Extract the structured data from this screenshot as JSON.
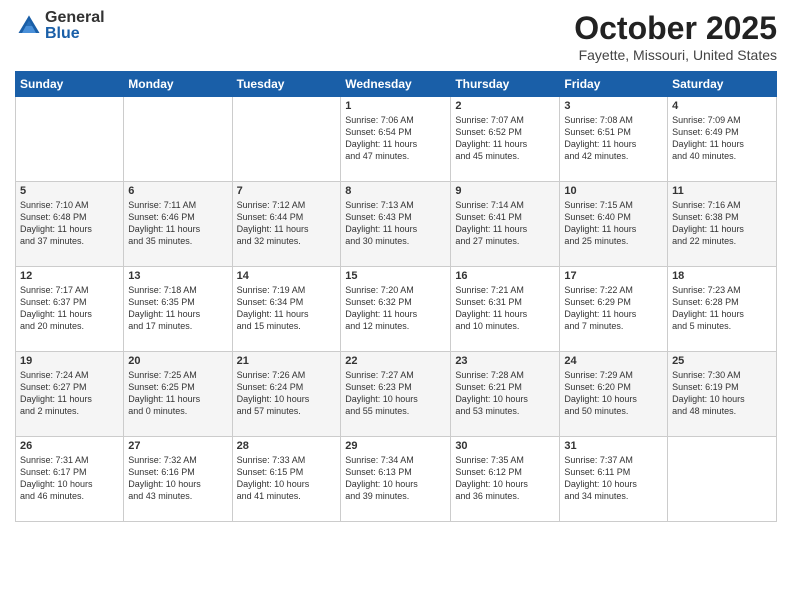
{
  "header": {
    "logo": {
      "general": "General",
      "blue": "Blue"
    },
    "title": "October 2025",
    "location": "Fayette, Missouri, United States"
  },
  "weekdays": [
    "Sunday",
    "Monday",
    "Tuesday",
    "Wednesday",
    "Thursday",
    "Friday",
    "Saturday"
  ],
  "weeks": [
    [
      {
        "day": "",
        "info": ""
      },
      {
        "day": "",
        "info": ""
      },
      {
        "day": "",
        "info": ""
      },
      {
        "day": "1",
        "info": "Sunrise: 7:06 AM\nSunset: 6:54 PM\nDaylight: 11 hours\nand 47 minutes."
      },
      {
        "day": "2",
        "info": "Sunrise: 7:07 AM\nSunset: 6:52 PM\nDaylight: 11 hours\nand 45 minutes."
      },
      {
        "day": "3",
        "info": "Sunrise: 7:08 AM\nSunset: 6:51 PM\nDaylight: 11 hours\nand 42 minutes."
      },
      {
        "day": "4",
        "info": "Sunrise: 7:09 AM\nSunset: 6:49 PM\nDaylight: 11 hours\nand 40 minutes."
      }
    ],
    [
      {
        "day": "5",
        "info": "Sunrise: 7:10 AM\nSunset: 6:48 PM\nDaylight: 11 hours\nand 37 minutes."
      },
      {
        "day": "6",
        "info": "Sunrise: 7:11 AM\nSunset: 6:46 PM\nDaylight: 11 hours\nand 35 minutes."
      },
      {
        "day": "7",
        "info": "Sunrise: 7:12 AM\nSunset: 6:44 PM\nDaylight: 11 hours\nand 32 minutes."
      },
      {
        "day": "8",
        "info": "Sunrise: 7:13 AM\nSunset: 6:43 PM\nDaylight: 11 hours\nand 30 minutes."
      },
      {
        "day": "9",
        "info": "Sunrise: 7:14 AM\nSunset: 6:41 PM\nDaylight: 11 hours\nand 27 minutes."
      },
      {
        "day": "10",
        "info": "Sunrise: 7:15 AM\nSunset: 6:40 PM\nDaylight: 11 hours\nand 25 minutes."
      },
      {
        "day": "11",
        "info": "Sunrise: 7:16 AM\nSunset: 6:38 PM\nDaylight: 11 hours\nand 22 minutes."
      }
    ],
    [
      {
        "day": "12",
        "info": "Sunrise: 7:17 AM\nSunset: 6:37 PM\nDaylight: 11 hours\nand 20 minutes."
      },
      {
        "day": "13",
        "info": "Sunrise: 7:18 AM\nSunset: 6:35 PM\nDaylight: 11 hours\nand 17 minutes."
      },
      {
        "day": "14",
        "info": "Sunrise: 7:19 AM\nSunset: 6:34 PM\nDaylight: 11 hours\nand 15 minutes."
      },
      {
        "day": "15",
        "info": "Sunrise: 7:20 AM\nSunset: 6:32 PM\nDaylight: 11 hours\nand 12 minutes."
      },
      {
        "day": "16",
        "info": "Sunrise: 7:21 AM\nSunset: 6:31 PM\nDaylight: 11 hours\nand 10 minutes."
      },
      {
        "day": "17",
        "info": "Sunrise: 7:22 AM\nSunset: 6:29 PM\nDaylight: 11 hours\nand 7 minutes."
      },
      {
        "day": "18",
        "info": "Sunrise: 7:23 AM\nSunset: 6:28 PM\nDaylight: 11 hours\nand 5 minutes."
      }
    ],
    [
      {
        "day": "19",
        "info": "Sunrise: 7:24 AM\nSunset: 6:27 PM\nDaylight: 11 hours\nand 2 minutes."
      },
      {
        "day": "20",
        "info": "Sunrise: 7:25 AM\nSunset: 6:25 PM\nDaylight: 11 hours\nand 0 minutes."
      },
      {
        "day": "21",
        "info": "Sunrise: 7:26 AM\nSunset: 6:24 PM\nDaylight: 10 hours\nand 57 minutes."
      },
      {
        "day": "22",
        "info": "Sunrise: 7:27 AM\nSunset: 6:23 PM\nDaylight: 10 hours\nand 55 minutes."
      },
      {
        "day": "23",
        "info": "Sunrise: 7:28 AM\nSunset: 6:21 PM\nDaylight: 10 hours\nand 53 minutes."
      },
      {
        "day": "24",
        "info": "Sunrise: 7:29 AM\nSunset: 6:20 PM\nDaylight: 10 hours\nand 50 minutes."
      },
      {
        "day": "25",
        "info": "Sunrise: 7:30 AM\nSunset: 6:19 PM\nDaylight: 10 hours\nand 48 minutes."
      }
    ],
    [
      {
        "day": "26",
        "info": "Sunrise: 7:31 AM\nSunset: 6:17 PM\nDaylight: 10 hours\nand 46 minutes."
      },
      {
        "day": "27",
        "info": "Sunrise: 7:32 AM\nSunset: 6:16 PM\nDaylight: 10 hours\nand 43 minutes."
      },
      {
        "day": "28",
        "info": "Sunrise: 7:33 AM\nSunset: 6:15 PM\nDaylight: 10 hours\nand 41 minutes."
      },
      {
        "day": "29",
        "info": "Sunrise: 7:34 AM\nSunset: 6:13 PM\nDaylight: 10 hours\nand 39 minutes."
      },
      {
        "day": "30",
        "info": "Sunrise: 7:35 AM\nSunset: 6:12 PM\nDaylight: 10 hours\nand 36 minutes."
      },
      {
        "day": "31",
        "info": "Sunrise: 7:37 AM\nSunset: 6:11 PM\nDaylight: 10 hours\nand 34 minutes."
      },
      {
        "day": "",
        "info": ""
      }
    ]
  ]
}
